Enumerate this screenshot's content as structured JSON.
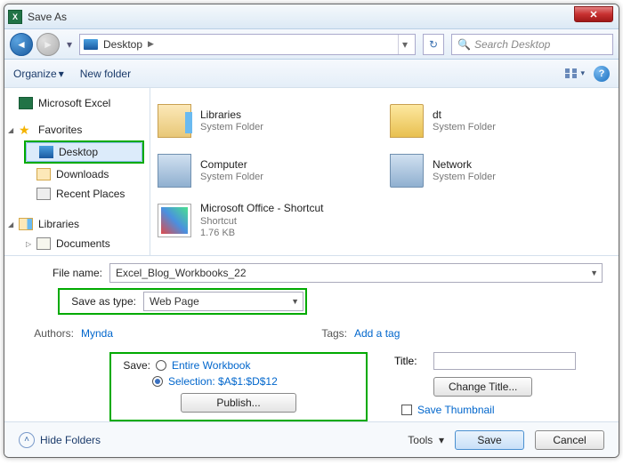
{
  "title": "Save As",
  "nav": {
    "location": "Desktop",
    "search_placeholder": "Search Desktop"
  },
  "toolbar": {
    "organize": "Organize",
    "newfolder": "New folder"
  },
  "sidebar": {
    "excel": "Microsoft Excel",
    "favorites": "Favorites",
    "desktop": "Desktop",
    "downloads": "Downloads",
    "recent": "Recent Places",
    "libraries": "Libraries",
    "documents": "Documents"
  },
  "items": [
    {
      "name": "Libraries",
      "sub1": "System Folder",
      "sub2": ""
    },
    {
      "name": "dt",
      "sub1": "System Folder",
      "sub2": ""
    },
    {
      "name": "Computer",
      "sub1": "System Folder",
      "sub2": ""
    },
    {
      "name": "Network",
      "sub1": "System Folder",
      "sub2": ""
    },
    {
      "name": "Microsoft Office - Shortcut",
      "sub1": "Shortcut",
      "sub2": "1.76 KB"
    }
  ],
  "labels": {
    "filename": "File name:",
    "savetype": "Save as type:",
    "authors": "Authors:",
    "tags": "Tags:",
    "addtag": "Add a tag",
    "save": "Save:",
    "entire": "Entire Workbook",
    "selection": "Selection: $A$1:$D$12",
    "publish": "Publish...",
    "title": "Title:",
    "changetitle": "Change Title...",
    "savethumb": "Save Thumbnail",
    "hidefolders": "Hide Folders",
    "tools": "Tools",
    "save_btn": "Save",
    "cancel": "Cancel"
  },
  "values": {
    "filename": "Excel_Blog_Workbooks_22",
    "savetype": "Web Page",
    "author": "Mynda"
  }
}
